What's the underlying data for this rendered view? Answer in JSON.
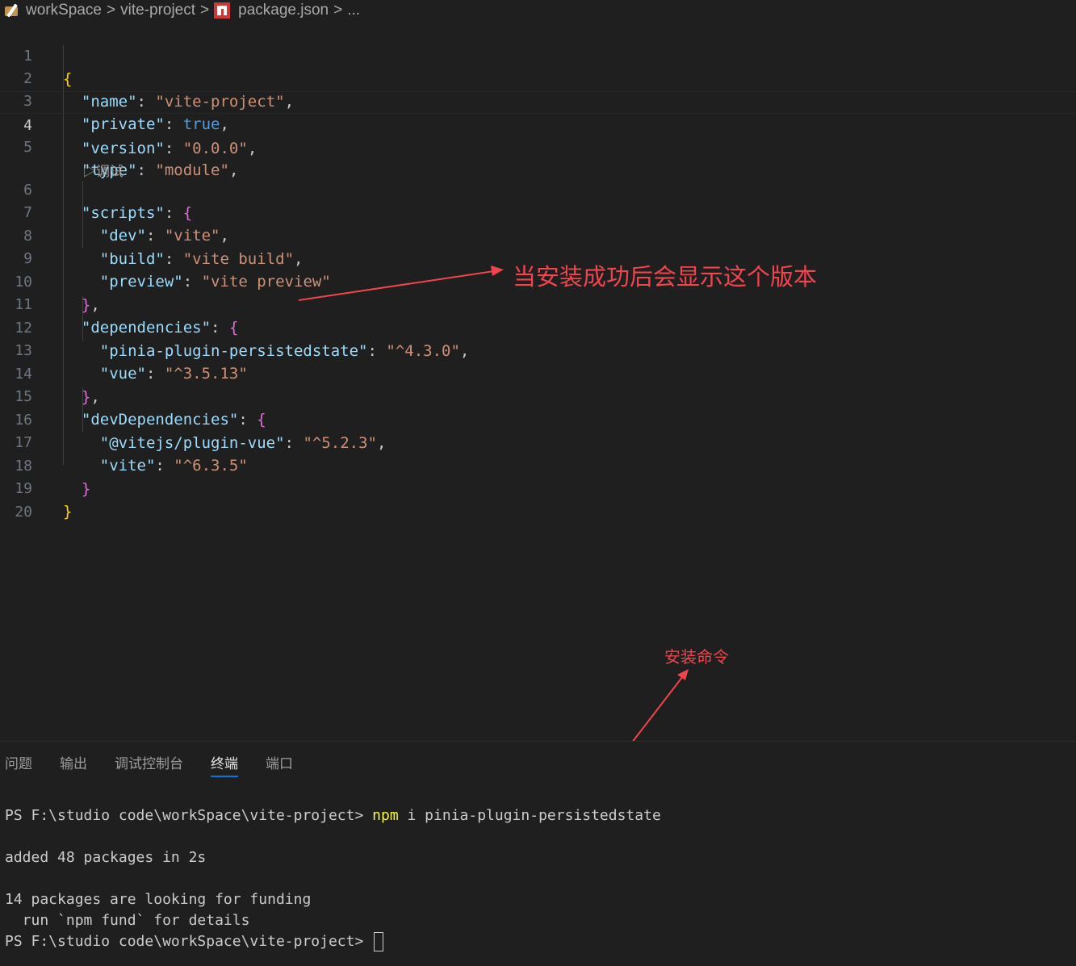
{
  "breadcrumb": {
    "items": [
      "workSpace",
      "vite-project",
      "package.json",
      "..."
    ],
    "separator": ">"
  },
  "editor": {
    "line_numbers": [
      "1",
      "2",
      "3",
      "4",
      "5",
      "6",
      "7",
      "8",
      "9",
      "10",
      "11",
      "12",
      "13",
      "14",
      "15",
      "16",
      "17",
      "18",
      "19",
      "20"
    ],
    "active_line": "4",
    "codelens": "▷调试",
    "code": {
      "name_key": "\"name\"",
      "name_val": "\"vite-project\"",
      "private_key": "\"private\"",
      "private_val": "true",
      "version_key": "\"version\"",
      "version_val": "\"0.0.0\"",
      "type_key": "\"type\"",
      "type_val": "\"module\"",
      "scripts_key": "\"scripts\"",
      "dev_key": "\"dev\"",
      "dev_val": "\"vite\"",
      "build_key": "\"build\"",
      "build_val": "\"vite build\"",
      "preview_key": "\"preview\"",
      "preview_val": "\"vite preview\"",
      "deps_key": "\"dependencies\"",
      "pinia_key": "\"pinia-plugin-persistedstate\"",
      "pinia_val": "\"^4.3.0\"",
      "vue_key": "\"vue\"",
      "vue_val": "\"^3.5.13\"",
      "devdeps_key": "\"devDependencies\"",
      "pluginvue_key": "\"@vitejs/plugin-vue\"",
      "pluginvue_val": "\"^5.2.3\"",
      "vite_key": "\"vite\"",
      "vite_val": "\"^6.3.5\""
    }
  },
  "annotations": {
    "version_note": "当安装成功后会显示这个版本",
    "install_note": "安装命令"
  },
  "panel": {
    "tabs": [
      "问题",
      "输出",
      "调试控制台",
      "终端",
      "端口"
    ],
    "active_tab": "终端"
  },
  "terminal": {
    "prompt": "PS F:\\studio code\\workSpace\\vite-project> ",
    "cmd_npm": "npm",
    "cmd_rest": " i pinia-plugin-persistedstate",
    "out1": "added 48 packages in 2s",
    "out2": "14 packages are looking for funding",
    "out3": "  run `npm fund` for details",
    "prompt2": "PS F:\\studio code\\workSpace\\vite-project> "
  },
  "colors": {
    "background": "#1f1f1f",
    "json_key": "#9cdcfe",
    "json_string": "#ce9178",
    "json_keyword": "#569cd6",
    "bracket_1": "#ffd700",
    "bracket_2": "#da70d6",
    "annotation_red": "#f0454e",
    "tab_underline": "#0078d4"
  }
}
